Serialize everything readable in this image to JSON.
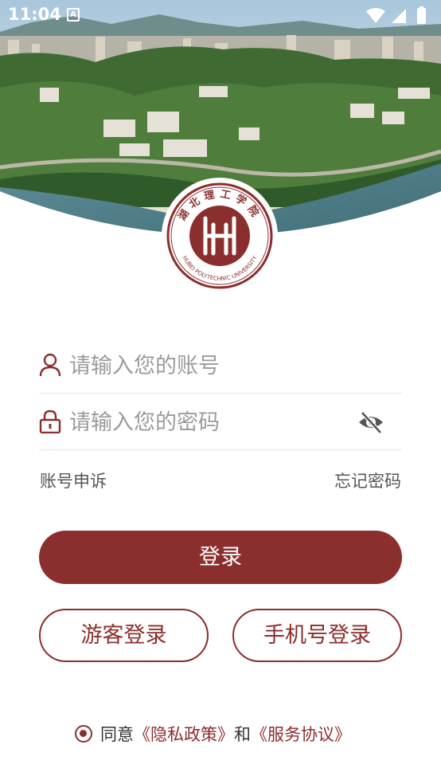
{
  "status_bar": {
    "time": "11:04",
    "notification_icon": "text-a-icon",
    "icons": [
      "wifi-icon",
      "signal-icon",
      "battery-icon"
    ]
  },
  "colors": {
    "brand": "#8b2e2e",
    "placeholder": "#9b9b9b",
    "divider": "#e8e8e8"
  },
  "logo": {
    "icon": "university-seal-icon",
    "seal_text_top": "湖北理工学院",
    "seal_text_bottom": "HUBEI POLYTECHNIC UNIVERSITY"
  },
  "form": {
    "account_placeholder": "请输入您的账号",
    "password_placeholder": "请输入您的密码",
    "account_icon": "user-icon",
    "password_icon": "lock-icon",
    "visibility_icon": "eye-off-icon"
  },
  "links": {
    "appeal": "账号申诉",
    "forgot": "忘记密码"
  },
  "buttons": {
    "login": "登录",
    "guest_login": "游客登录",
    "phone_login": "手机号登录"
  },
  "agreement": {
    "prefix": "同意",
    "privacy": "《隐私政策》",
    "and": "和",
    "service": "《服务协议》"
  }
}
